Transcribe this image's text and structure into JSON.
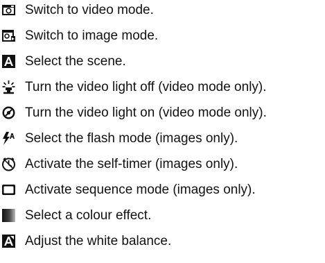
{
  "items": [
    {
      "icon": "video-camera-icon",
      "text": "Switch to video mode."
    },
    {
      "icon": "camera-icon",
      "text": "Switch to image mode."
    },
    {
      "icon": "scene-icon",
      "text": "Select the scene."
    },
    {
      "icon": "video-light-off-icon",
      "text": "Turn the video light off (video mode only)."
    },
    {
      "icon": "video-light-on-icon",
      "text": "Turn the video light on (video mode only)."
    },
    {
      "icon": "flash-icon",
      "text": "Select the flash mode (images only)."
    },
    {
      "icon": "self-timer-icon",
      "text": "Activate the self-timer (images only)."
    },
    {
      "icon": "sequence-icon",
      "text": "Activate sequence mode (images only)."
    },
    {
      "icon": "colour-effect-icon",
      "text": "Select a colour effect."
    },
    {
      "icon": "white-balance-icon",
      "text": "Adjust the white balance."
    }
  ]
}
